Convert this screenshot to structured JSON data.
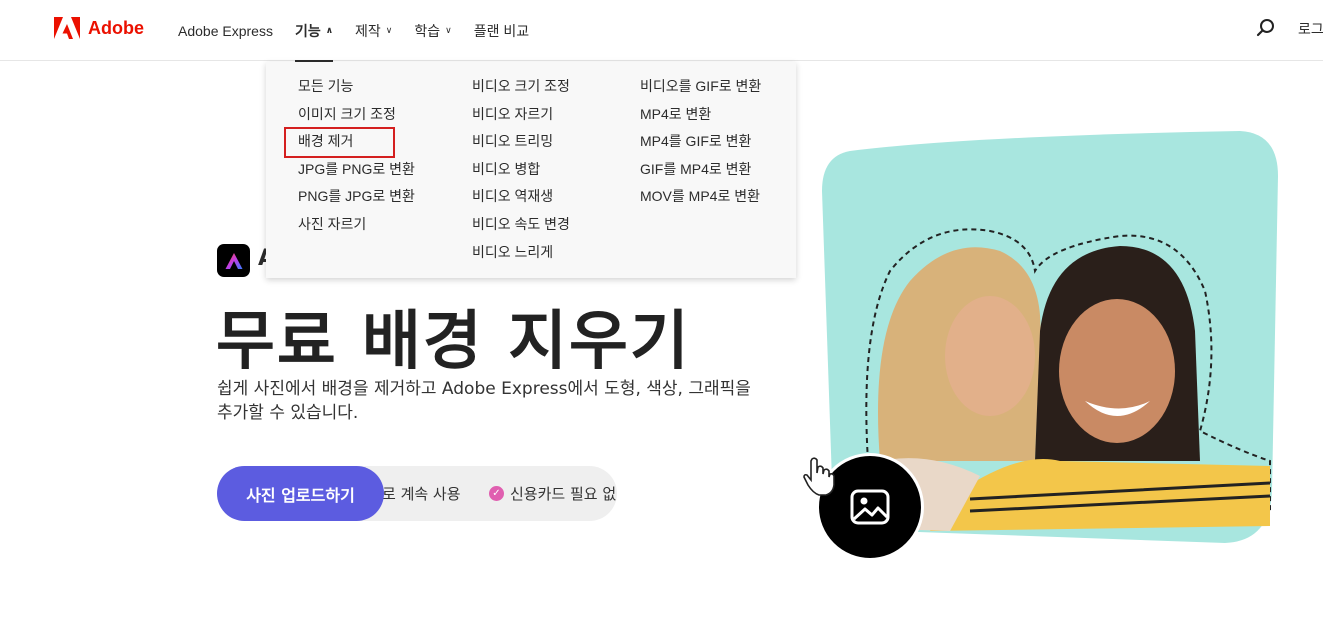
{
  "header": {
    "logo_text": "Adobe",
    "nav": [
      {
        "label": "Adobe Express",
        "chevron": false,
        "active": false
      },
      {
        "label": "기능",
        "chevron": true,
        "active": true
      },
      {
        "label": "제작",
        "chevron": true,
        "active": false
      },
      {
        "label": "학습",
        "chevron": true,
        "active": false
      },
      {
        "label": "플랜 비교",
        "chevron": false,
        "active": false
      }
    ],
    "login": "로그인",
    "icons": {
      "search": "search-icon"
    }
  },
  "dropdown": {
    "col1": [
      "모든 기능",
      "이미지 크기 조정",
      "배경 제거",
      "JPG를 PNG로 변환",
      "PNG를 JPG로 변환",
      "사진 자르기"
    ],
    "col2": [
      "비디오 크기 조정",
      "비디오 자르기",
      "비디오 트리밍",
      "비디오 병합",
      "비디오 역재생",
      "비디오 속도 변경",
      "비디오 느리게"
    ],
    "col3": [
      "비디오를 GIF로 변환",
      "MP4로 변환",
      "MP4를 GIF로 변환",
      "GIF를 MP4로 변환",
      "MOV를 MP4로 변환"
    ],
    "highlighted": "배경 제거"
  },
  "hero": {
    "badge_text": "A",
    "title": "무료 배경 지우기",
    "subtitle": "쉽게 사진에서 배경을 제거하고 Adobe Express에서 도형, 색상, 그래픽을 추가할 수 있습니다.",
    "upload_button": "사진 업로드하기",
    "pill_text_1": "로 계속 사용",
    "pill_text_2": "신용카드 필요 없",
    "check_icon": "check-icon"
  },
  "colors": {
    "adobe_red": "#eb1000",
    "button_purple": "#5c5ce0",
    "photo_bg": "#a8e6df",
    "highlight_red": "#d41f1f"
  }
}
